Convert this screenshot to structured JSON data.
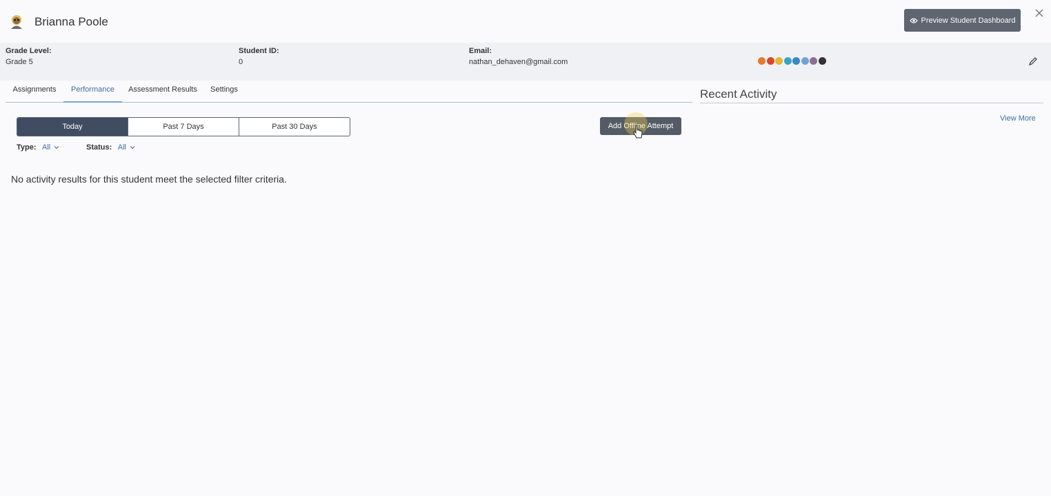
{
  "header": {
    "student_name": "Brianna Poole",
    "preview_label": "Preview Student Dashboard",
    "avatar_icon": "student-avatar-icon",
    "close_icon": "close-icon"
  },
  "info": {
    "grade_label": "Grade Level:",
    "grade_value": "Grade 5",
    "id_label": "Student ID:",
    "id_value": "0",
    "email_label": "Email:",
    "email_value": "nathan_dehaven@gmail.com",
    "badge_colors": [
      "#e27c2b",
      "#d9452f",
      "#e8b531",
      "#37a5c4",
      "#3d85c6",
      "#6fa3d8",
      "#8e6f8e",
      "#333333"
    ]
  },
  "tabs": [
    {
      "label": "Assignments",
      "active": false
    },
    {
      "label": "Performance",
      "active": true
    },
    {
      "label": "Assessment Results",
      "active": false
    },
    {
      "label": "Settings",
      "active": false
    }
  ],
  "date_filter": {
    "options": [
      "Today",
      "Past 7 Days",
      "Past 30 Days"
    ],
    "selected": "Today"
  },
  "offline_button_label": "Add Offline Attempt",
  "filters": {
    "type_label": "Type:",
    "type_value": "All",
    "status_label": "Status:",
    "status_value": "All"
  },
  "empty_message": "No activity results for this student meet the selected filter criteria.",
  "recent_activity": {
    "title": "Recent Activity",
    "view_more": "View More"
  }
}
